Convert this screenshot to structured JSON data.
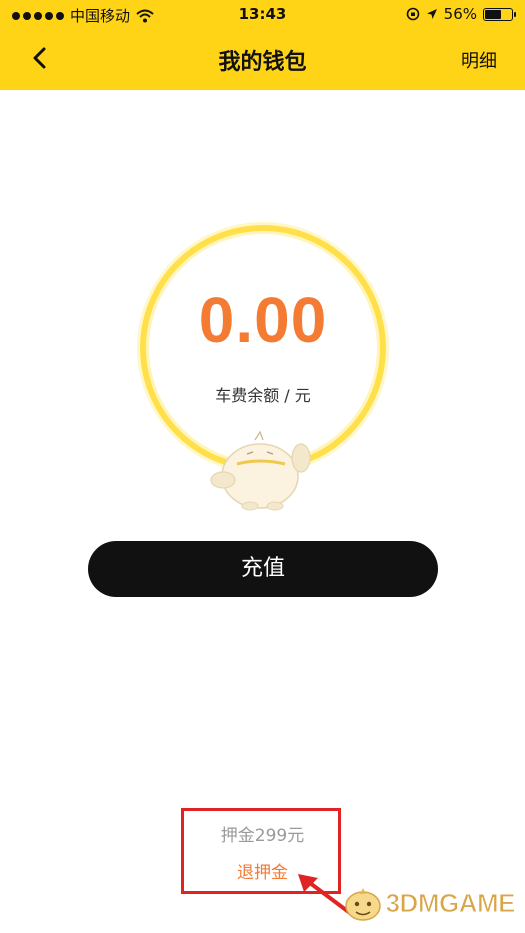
{
  "status_bar": {
    "carrier": "中国移动",
    "time": "13:43",
    "battery": "56%",
    "battery_level": 0.56
  },
  "header": {
    "back_icon": "chevron-left-icon",
    "title": "我的钱包",
    "detail_label": "明细",
    "color": "#ffd316"
  },
  "balance": {
    "amount": "0.00",
    "label": "车费余额 / 元",
    "amount_color": "#f47b34",
    "ring_color": "#ffe04a"
  },
  "recharge": {
    "label": "充值"
  },
  "deposit": {
    "text": "押金299元",
    "refund_label": "退押金",
    "highlight_color": "#e02424"
  },
  "watermark": {
    "text": "3DMGAME"
  }
}
